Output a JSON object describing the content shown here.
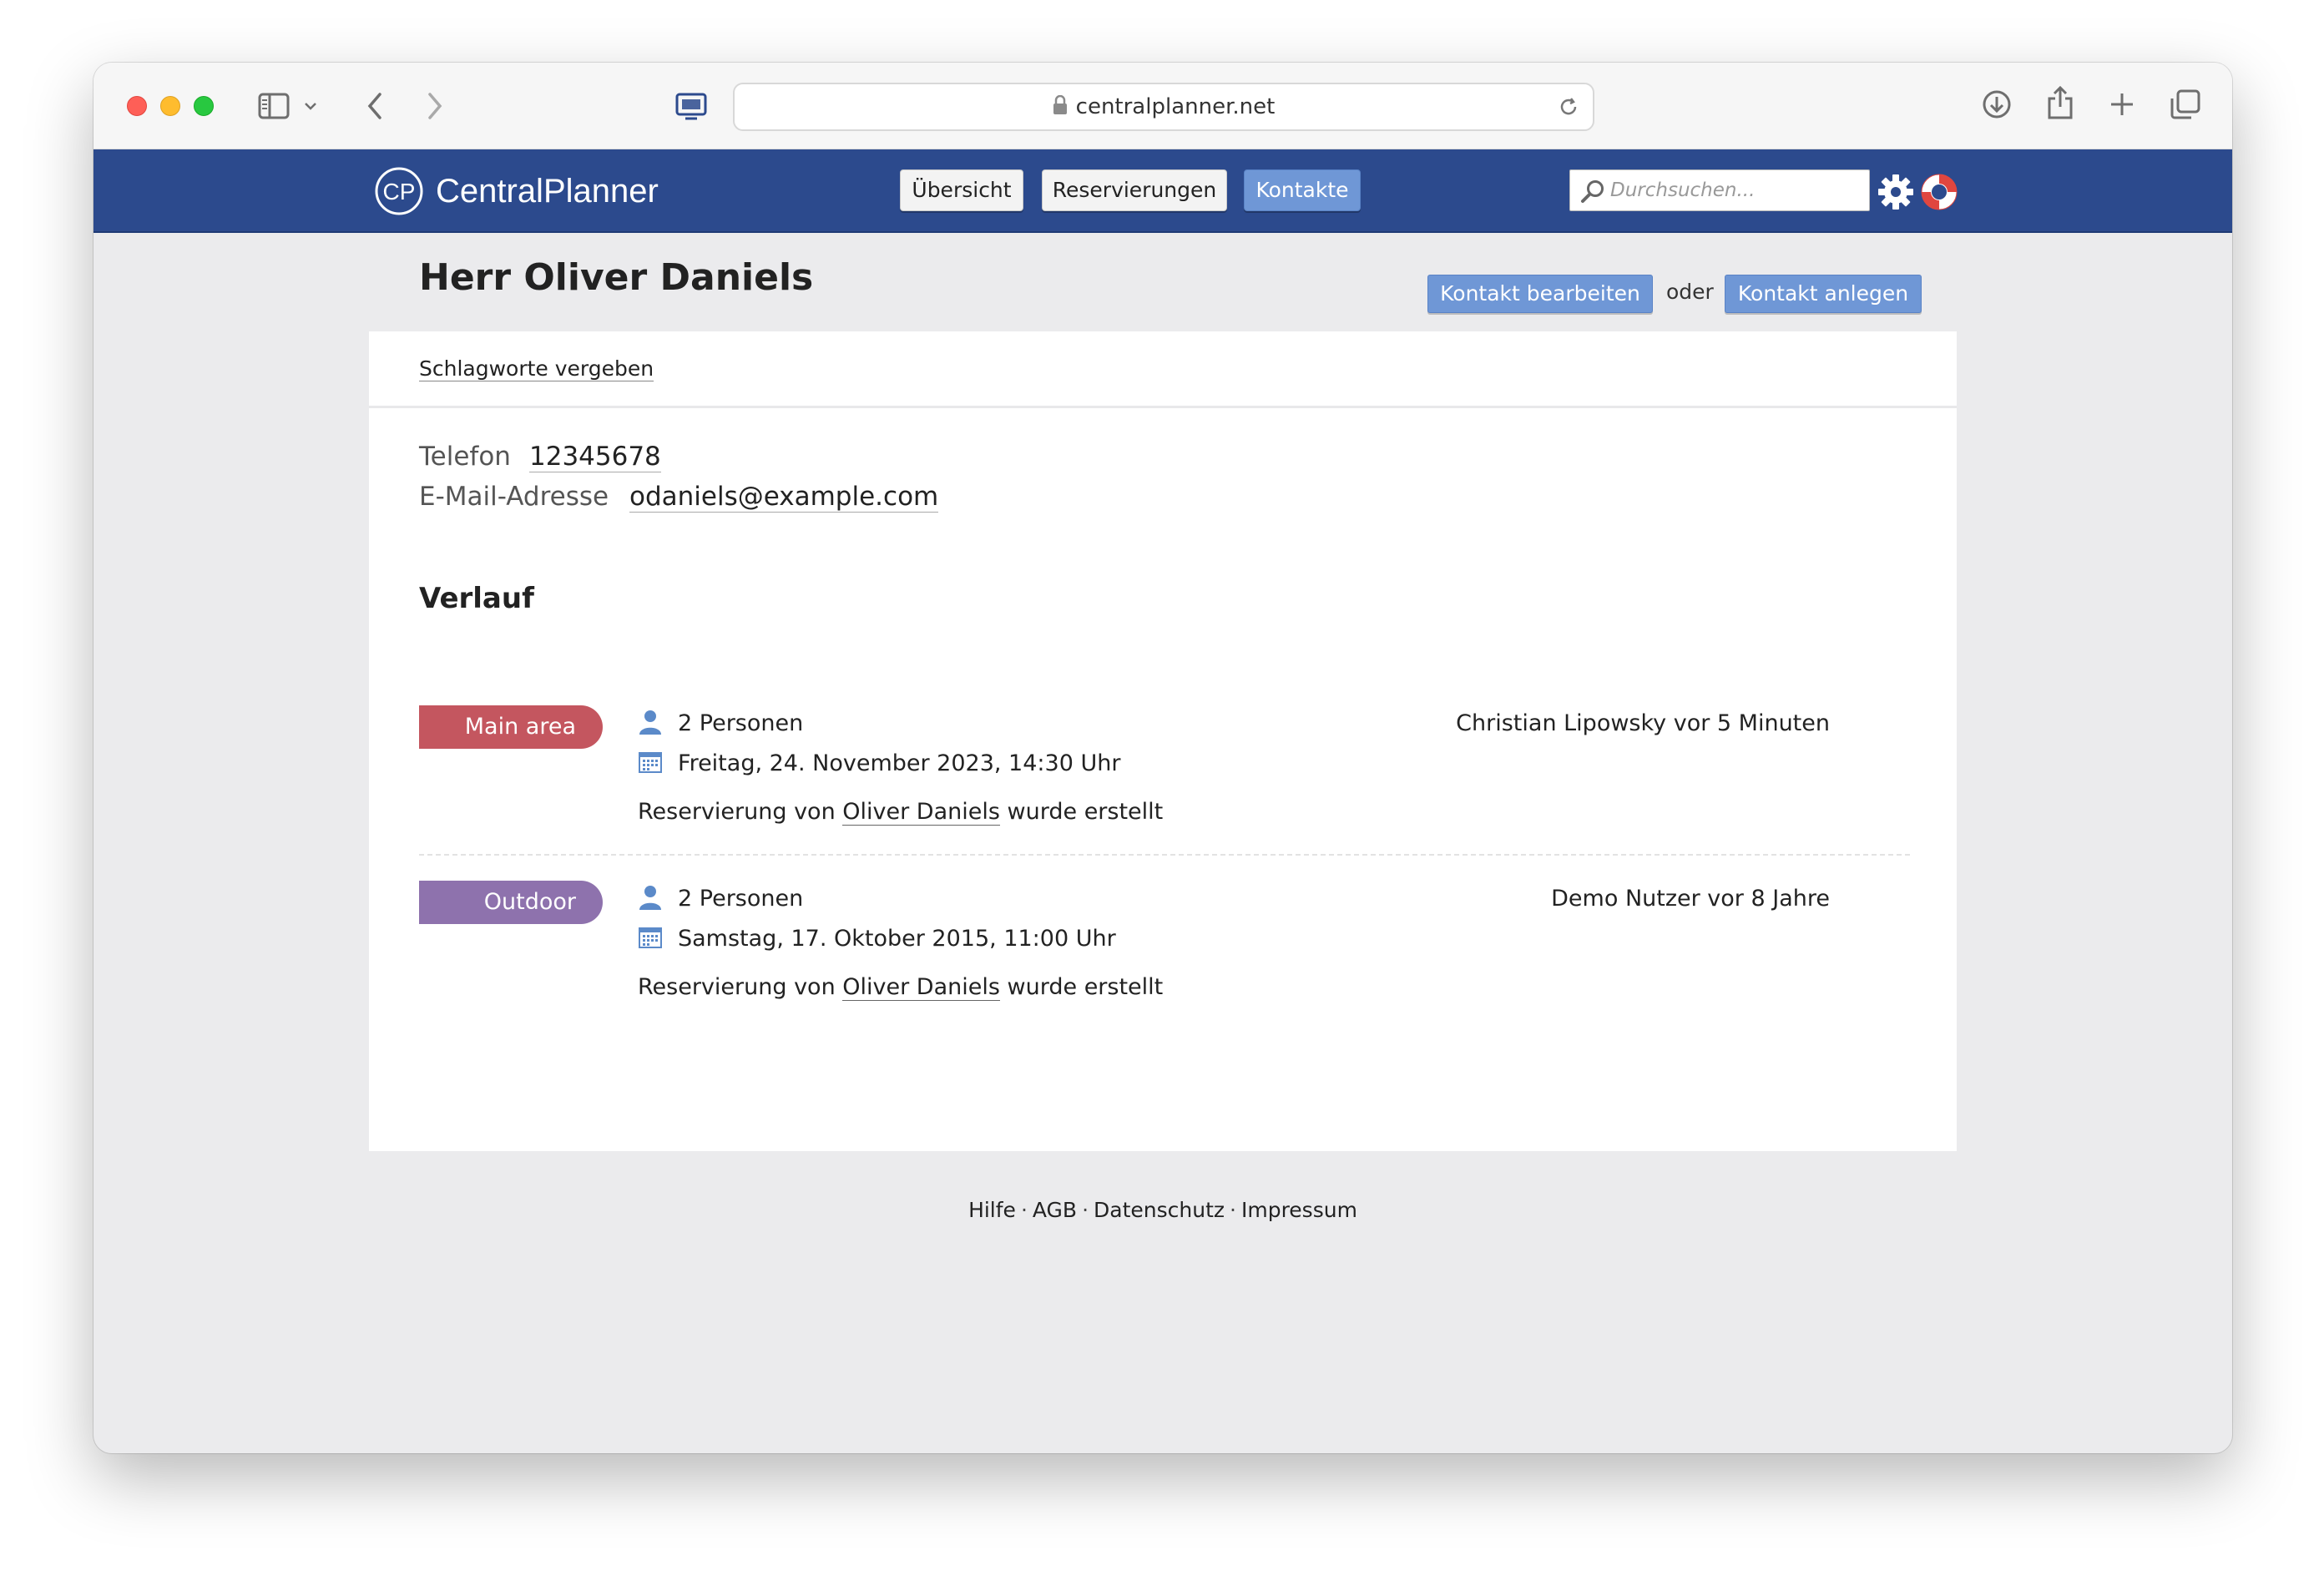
{
  "browser": {
    "url": "centralplanner.net"
  },
  "app": {
    "brand_mark": "CP",
    "brand_name": "CentralPlanner",
    "nav": [
      {
        "label": "Übersicht",
        "active": false
      },
      {
        "label": "Reservierungen",
        "active": false
      },
      {
        "label": "Kontakte",
        "active": true
      }
    ],
    "search_placeholder": "Durchsuchen..."
  },
  "contact": {
    "title": "Herr Oliver Daniels",
    "edit_label": "Kontakt bearbeiten",
    "or_label": "oder",
    "create_label": "Kontakt anlegen",
    "tags_link": "Schlagworte vergeben",
    "phone_label": "Telefon",
    "phone_value": "12345678",
    "email_label": "E-Mail-Adresse",
    "email_value": "odaniels@example.com"
  },
  "history": {
    "title": "Verlauf",
    "entries": [
      {
        "area": "Main area",
        "area_color": "#c4565f",
        "persons": "2 Personen",
        "date": "Freitag, 24. November 2023, 14:30 Uhr",
        "msg_prefix": "Reservierung von ",
        "msg_name": "Oliver Daniels",
        "msg_suffix": " wurde erstellt",
        "meta": "Christian Lipowsky vor 5 Minuten"
      },
      {
        "area": "Outdoor",
        "area_color": "#8e72ad",
        "persons": "2 Personen",
        "date": "Samstag, 17. Oktober 2015, 11:00 Uhr",
        "msg_prefix": "Reservierung von ",
        "msg_name": "Oliver Daniels",
        "msg_suffix": " wurde erstellt",
        "meta": "Demo Nutzer vor 8 Jahre"
      }
    ]
  },
  "footer": {
    "links": [
      "Hilfe",
      "AGB",
      "Datenschutz",
      "Impressum"
    ],
    "separator": "·"
  },
  "colors": {
    "header_bg": "#2c4a8d",
    "accent_button": "#6f97d6",
    "page_bg": "#ebebed"
  }
}
